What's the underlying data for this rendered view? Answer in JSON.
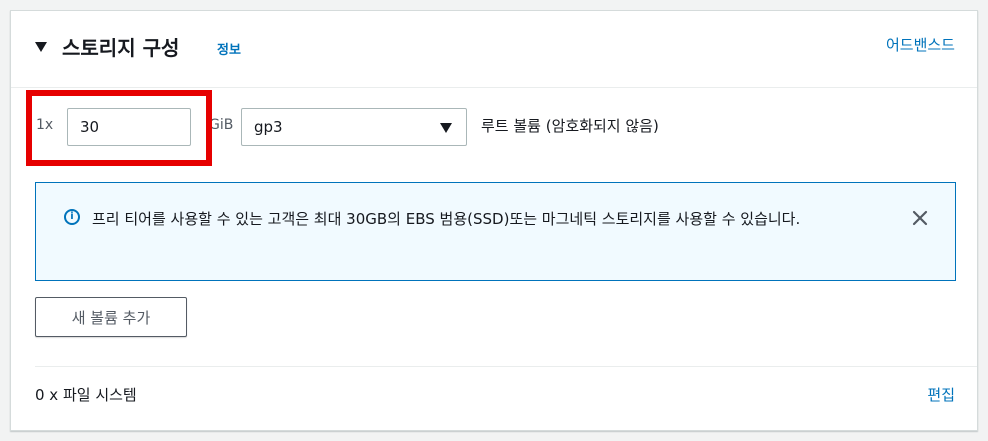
{
  "section": {
    "title": "스토리지 구성",
    "info_link": "정보",
    "advanced_link": "어드밴스드"
  },
  "volume": {
    "count_prefix": "1x",
    "size_value": "30",
    "unit": "GiB",
    "volume_type": "gp3",
    "root_label": "루트 볼륨  (암호화되지 않음)"
  },
  "alert": {
    "icon": "info-icon",
    "text": "프리 티어를 사용할 수 있는 고객은 최대 30GB의 EBS 범용(SSD)또는 마그네틱 스토리지를 사용할 수 있습니다.",
    "close_icon": "close-icon"
  },
  "actions": {
    "add_volume_label": "새 볼륨 추가"
  },
  "filesystem": {
    "label": "0 x 파일 시스템",
    "edit_link": "편집"
  },
  "colors": {
    "link": "#0073bb",
    "highlight": "#e60000",
    "alert_bg": "#f1faff"
  }
}
